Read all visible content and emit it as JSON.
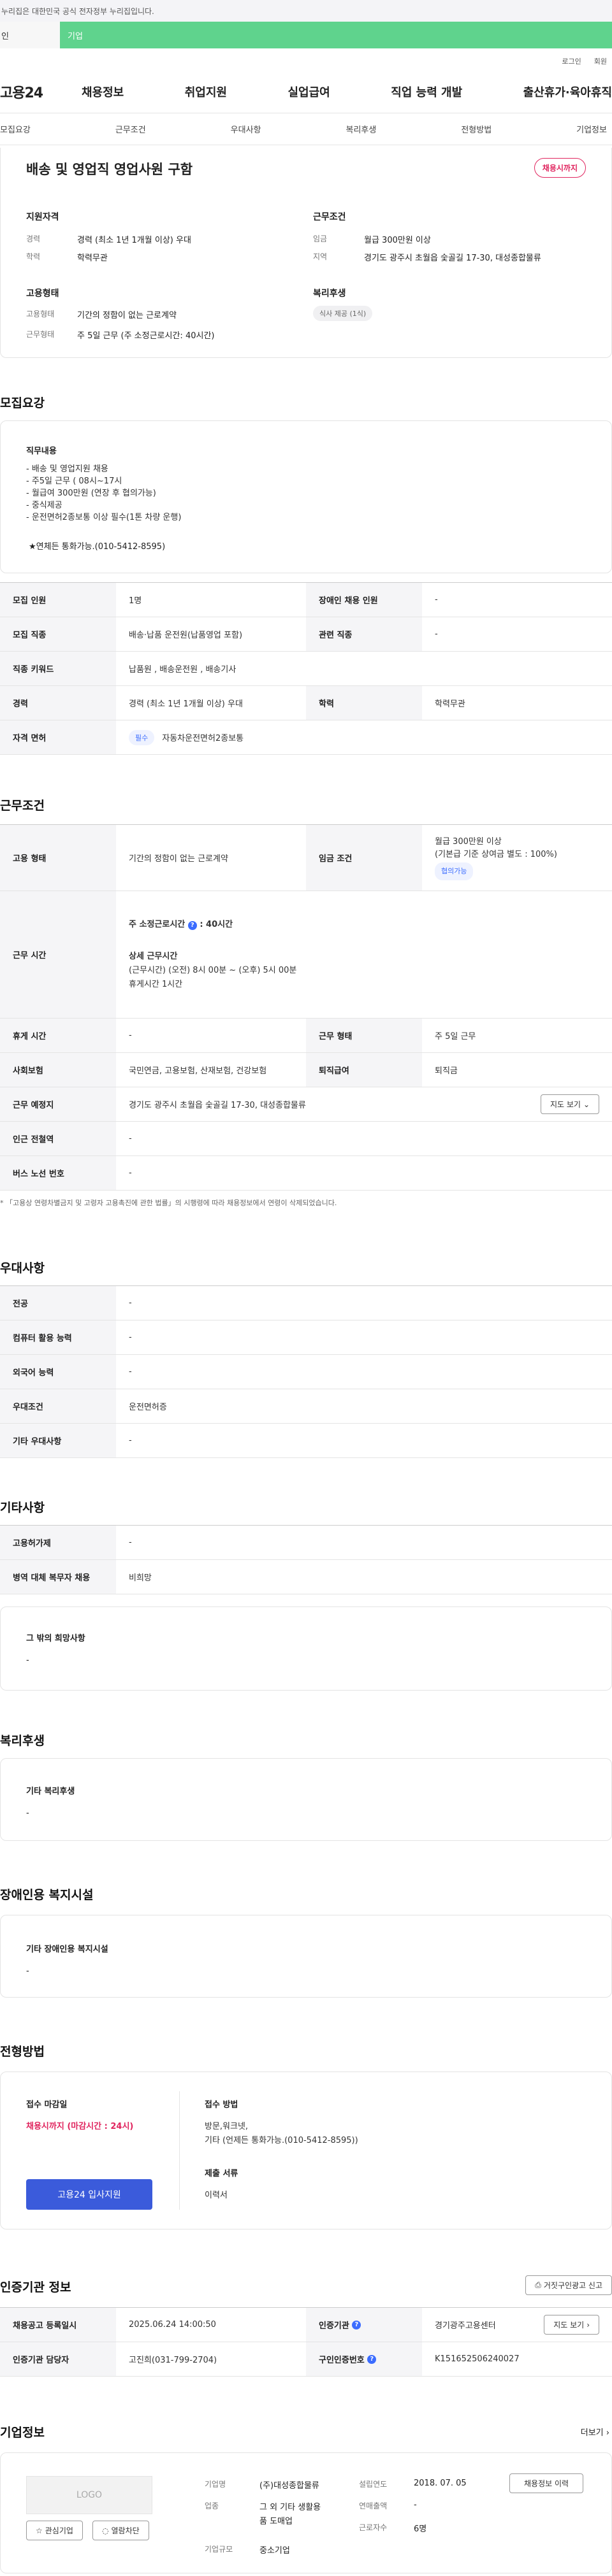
{
  "gov_notice": "누리집은 대한민국 공식 전자정부 누리집입니다.",
  "tabs": [
    "인",
    "기업"
  ],
  "util": [
    "로그인",
    "회원"
  ],
  "logo": "고용24",
  "gnb": [
    "채용정보",
    "취업지원",
    "실업급여",
    "직업 능력 개발",
    "출산휴가·육아휴직"
  ],
  "subnav": [
    "모집요강",
    "근무조건",
    "우대사항",
    "복리후생",
    "전형방법",
    "기업정보"
  ],
  "job": {
    "title": "배송 및 영업직 영업사원 구함",
    "status": "채용시까지",
    "qual_title": "지원자격",
    "career_lbl": "경력",
    "career": "경력 (최소 1년 1개월 이상) 우대",
    "edu_lbl": "학력",
    "edu": "학력무관",
    "cond_title": "근무조건",
    "wage_lbl": "임금",
    "wage": "월급 300만원 이상",
    "area_lbl": "지역",
    "area": "경기도 광주시 초월읍 숯골길 17-30, 대성종합물류",
    "emp_title": "고용형태",
    "emptype_lbl": "고용형태",
    "emptype": "기간의 정함이 없는 근로계약",
    "worktype_lbl": "근무형태",
    "worktype": "주 5일 근무 (주 소정근로시간: 40시간)",
    "welfare_title": "복리후생",
    "welfare_pill": "식사 제공 (1식)"
  },
  "recruit": {
    "title": "모집요강",
    "desc_title": "직무내용",
    "desc": [
      "- 배송 및 영업지원 채용",
      "- 주5일 근무 ( 08시~17시",
      "- 월급여 300만원 (연장 후 협의가능)",
      "- 중식제공",
      "- 운전면허2종보통 이상 필수(1톤 차량 운행)"
    ],
    "contact": "★연체든 통화가능.(010-5412-8595)",
    "r1_l1": "모집 인원",
    "r1_v1": "1명",
    "r1_l2": "장애인 채용 인원",
    "r1_v2": "-",
    "r2_l1": "모집 직종",
    "r2_v1": "배송·납품 운전원(납품영업 포함)",
    "r2_l2": "관련 직종",
    "r2_v2": "-",
    "r3_l": "직종 키워드",
    "r3_v": "납품원 , 배송운전원 , 배송기사",
    "r4_l1": "경력",
    "r4_v1": "경력 (최소 1년 1개월 이상) 우대",
    "r4_l2": "학력",
    "r4_v2": "학력무관",
    "r5_l": "자격 면허",
    "r5_tag": "필수",
    "r5_v": "자동차운전면허2종보통"
  },
  "conditions": {
    "title": "근무조건",
    "emp_l": "고용 형태",
    "emp_v": "기간의 정함이 없는 근로계약",
    "wage_l": "임금 조건",
    "wage_v1": "월급 300만원 이상",
    "wage_v2": "(기본급 기준 상여금 별도 : 100%)",
    "wage_tag": "협의가능",
    "time_l": "근무 시간",
    "time_v1": "주 소정근로시간",
    "time_v1b": ": 40시간",
    "time_d_t": "상세 근무시간",
    "time_d1": "(근무시간) (오전) 8시 00분 ~ (오후) 5시 00분",
    "time_d2": "휴게시간 1시간",
    "rest_l": "휴게 시간",
    "rest_v": "-",
    "type_l": "근무 형태",
    "type_v": "주 5일 근무",
    "ins_l": "사회보험",
    "ins_v": "국민연금, 고용보험, 산재보험, 건강보험",
    "ret_l": "퇴직급여",
    "ret_v": "퇴직금",
    "place_l": "근무 예정지",
    "place_v": "경기도 광주시 초월읍 숯골길 17-30, 대성종합물류",
    "map_btn": "지도 보기",
    "subway_l": "인근 전철역",
    "subway_v": "-",
    "bus_l": "버스 노선 번호",
    "bus_v": "-",
    "note": "* 「고용상 연령차별금지 및 고령자 고용촉진에 관한 법률」의 시행령에 따라 채용정보에서 연령이 삭제되었습니다."
  },
  "pref": {
    "title": "우대사항",
    "rows": [
      [
        "전공",
        "-"
      ],
      [
        "컴퓨터 활용 능력",
        "-"
      ],
      [
        "외국어 능력",
        "-"
      ],
      [
        "우대조건",
        "운전면허증"
      ],
      [
        "기타 우대사항",
        "-"
      ]
    ]
  },
  "etc": {
    "title": "기타사항",
    "rows": [
      [
        "고용허가제",
        "-"
      ],
      [
        "병역 대체 복무자 채용",
        "비희망"
      ]
    ],
    "wish_t": "그 밖의 희망사항",
    "wish_v": "-"
  },
  "welfare": {
    "title": "복리후생",
    "box_t": "기타 복리후생",
    "box_v": "-"
  },
  "disabled": {
    "title": "장애인용 복지시설",
    "box_t": "기타 장애인용 복지시설",
    "box_v": "-"
  },
  "selection": {
    "title": "전형방법",
    "deadline_t": "접수 마감일",
    "deadline_v": "채용시까지 (마감시간 : 24시)",
    "apply_btn": "고용24 입사지원",
    "method_t": "접수 방법",
    "method_v1": "방문,워크넷,",
    "method_v2": "기타 (언제든 통화가능.(010-5412-8595))",
    "docs_t": "제출 서류",
    "docs_v": "이력서"
  },
  "cert": {
    "title": "인증기관 정보",
    "report_btn": "거짓구인광고 신고",
    "r1_l1": "채용공고 등록일시",
    "r1_v1": "2025.06.24 14:00:50",
    "r1_l2": "인증기관",
    "r1_v2": "경기광주고용센터",
    "map_btn": "지도 보기",
    "r2_l1": "인증기관 담당자",
    "r2_v1": "고진희(031-799-2704)",
    "r2_l2": "구인인증번호",
    "r2_v2": "K151652506240027"
  },
  "company": {
    "title": "기업정보",
    "more": "더보기",
    "logo": "LOGO",
    "fav_btn": "관심기업",
    "block_btn": "열람차단",
    "name_l": "기업명",
    "name_v": "(주)대성종합물류",
    "year_l": "설립연도",
    "year_v": "2018. 07. 05",
    "history_btn": "채용정보 이력",
    "ind_l": "업종",
    "ind_v1": "그 외 기타 생활용",
    "ind_v2": "품 도매업",
    "sales_l": "연매출액",
    "sales_v": "-",
    "emp_l": "근로자수",
    "emp_v": "6명",
    "size_l": "기업규모",
    "size_v": "중소기업"
  }
}
